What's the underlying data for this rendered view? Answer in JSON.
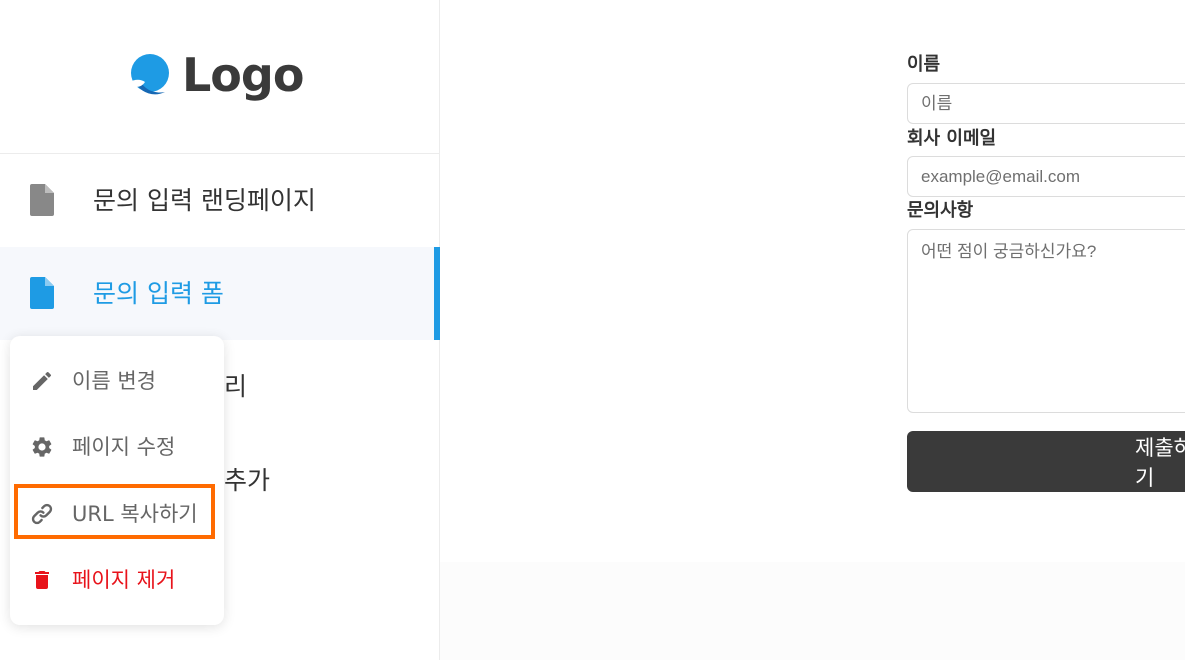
{
  "logo": {
    "text": "Logo",
    "accent_color": "#1e9be4"
  },
  "sidebar": {
    "items": [
      {
        "label": "문의 입력 랜딩페이지",
        "icon": "document-icon",
        "active": false
      },
      {
        "label": "문의 입력 폼",
        "icon": "document-icon",
        "active": true
      }
    ],
    "partial_items": [
      "리",
      "추가"
    ]
  },
  "context_menu": {
    "items": [
      {
        "label": "이름 변경",
        "icon": "pencil-icon"
      },
      {
        "label": "페이지 수정",
        "icon": "gear-icon"
      },
      {
        "label": "URL 복사하기",
        "icon": "link-icon",
        "highlighted": true
      },
      {
        "label": "페이지 제거",
        "icon": "trash-icon",
        "danger": true
      }
    ]
  },
  "form": {
    "name_label": "이름",
    "name_placeholder": "이름",
    "email_label": "회사 이메일",
    "email_placeholder": "example@email.com",
    "inquiry_label": "문의사항",
    "inquiry_placeholder": "어떤 점이 궁금하신가요?",
    "submit_label": "제출하기"
  },
  "colors": {
    "active": "#1e9be4",
    "danger": "#e8131b",
    "highlight": "#ff6b00",
    "button": "#3a3a3a"
  }
}
